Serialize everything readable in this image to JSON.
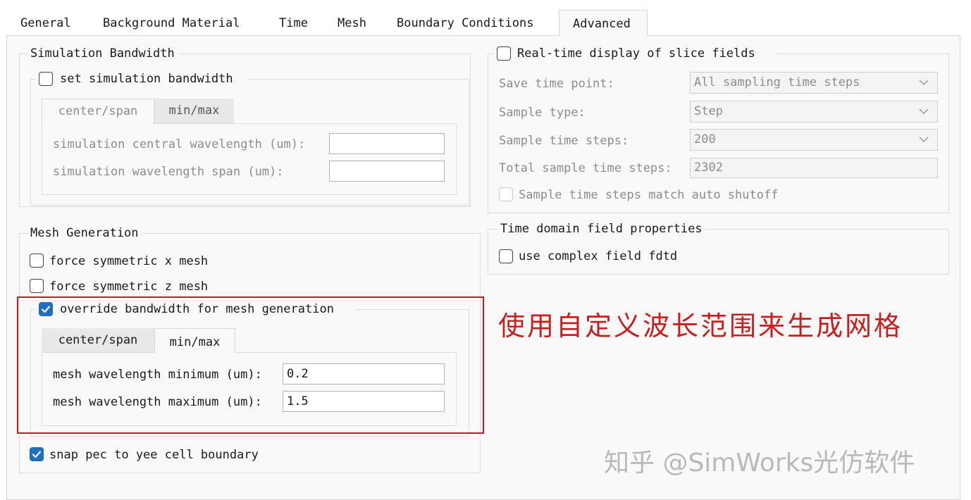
{
  "tabs": [
    "General",
    "Background Material",
    "Time",
    "Mesh",
    "Boundary Conditions",
    "Advanced"
  ],
  "active_tab": "Advanced",
  "simulation_bandwidth": {
    "title": "Simulation Bandwidth",
    "set_bandwidth_label": "set simulation bandwidth",
    "set_bandwidth_checked": false,
    "subtabs": [
      "center/span",
      "min/max"
    ],
    "active_subtab": "center/span",
    "central_wavelength_label": "simulation central wavelength (um):",
    "central_wavelength_value": "",
    "wavelength_span_label": "simulation wavelength span (um):",
    "wavelength_span_value": ""
  },
  "mesh_generation": {
    "title": "Mesh Generation",
    "force_sym_x_label": "force symmetric x mesh",
    "force_sym_x_checked": false,
    "force_sym_z_label": "force symmetric z mesh",
    "force_sym_z_checked": false,
    "override_label": "override bandwidth for mesh generation",
    "override_checked": true,
    "subtabs": [
      "center/span",
      "min/max"
    ],
    "active_subtab": "min/max",
    "min_label": "mesh wavelength minimum (um):",
    "min_value": "0.2",
    "max_label": "mesh wavelength maximum (um):",
    "max_value": "1.5",
    "snap_pec_label": "snap pec to yee cell boundary",
    "snap_pec_checked": true
  },
  "realtime": {
    "title": "Real-time display of slice fields",
    "checked": false,
    "save_time_point_label": "Save time point:",
    "save_time_point_value": "All sampling time steps",
    "sample_type_label": "Sample type:",
    "sample_type_value": "Step",
    "sample_time_steps_label": "Sample time steps:",
    "sample_time_steps_value": "200",
    "total_steps_label": "Total sample time steps:",
    "total_steps_value": "2302",
    "match_shutoff_label": "Sample time steps match auto shutoff",
    "match_shutoff_checked": false
  },
  "time_domain": {
    "title": "Time domain field properties",
    "complex_label": "use complex field fdtd",
    "complex_checked": false
  },
  "annotation": "使用自定义波长范围来生成网格",
  "watermark": "知乎 @SimWorks光仿软件",
  "colors": {
    "accent": "#1f6fbf",
    "annotation": "#c81e1e",
    "highlight": "#b22222"
  }
}
